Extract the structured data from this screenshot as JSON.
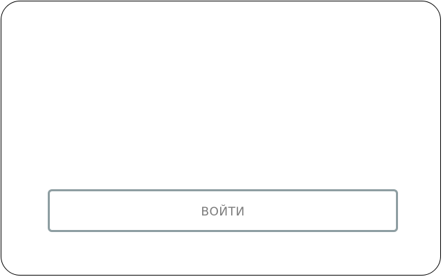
{
  "login": {
    "button_label": "ВОЙТИ"
  },
  "colors": {
    "card_border": "#000000",
    "button_border": "#8e9ea2",
    "button_text": "#7b7b7b",
    "background": "#ffffff"
  }
}
